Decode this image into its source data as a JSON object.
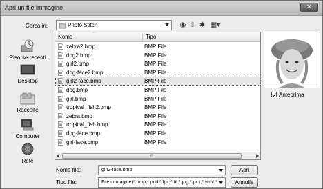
{
  "window": {
    "title": "Apri un file immagine",
    "close_glyph": "✕"
  },
  "lookin": {
    "label": "Cerca in:",
    "value": "Photo Stitch"
  },
  "toolbar": {
    "back": "◉",
    "up": "⇧",
    "new_folder": "✱",
    "views": "▦▾"
  },
  "places": [
    {
      "label": "Risorse recenti",
      "icon": "recent-places-icon"
    },
    {
      "label": "Desktop",
      "icon": "desktop-icon"
    },
    {
      "label": "Raccolte",
      "icon": "libraries-icon"
    },
    {
      "label": "Computer",
      "icon": "computer-icon"
    },
    {
      "label": "Rete",
      "icon": "network-icon"
    }
  ],
  "columns": {
    "name": "Nome",
    "type": "Tipo"
  },
  "files": [
    {
      "name": "zebra2.bmp",
      "type": "BMP File"
    },
    {
      "name": "dog2.bmp",
      "type": "BMP File"
    },
    {
      "name": "girl2.bmp",
      "type": "BMP File"
    },
    {
      "name": "dog-face2.bmp",
      "type": "BMP File"
    },
    {
      "name": "girl2-face.bmp",
      "type": "BMP File",
      "selected": true
    },
    {
      "name": "dog.bmp",
      "type": "BMP File"
    },
    {
      "name": "girl.bmp",
      "type": "BMP File"
    },
    {
      "name": "tropical_fish2.bmp",
      "type": "BMP File"
    },
    {
      "name": "zebra.bmp",
      "type": "BMP File"
    },
    {
      "name": "tropical_fish.bmp",
      "type": "BMP File"
    },
    {
      "name": "dog-face.bmp",
      "type": "BMP File"
    },
    {
      "name": "girl-face.bmp",
      "type": "BMP File"
    }
  ],
  "preview": {
    "checkbox_label": "Anteprima",
    "checked": true
  },
  "filename": {
    "label": "Nome file:",
    "value": "girl2-face.bmp"
  },
  "filetype": {
    "label": "Tipo file:",
    "value": "File immagine(*.bmp;*.pcd;*.fpx;*.tif;*.jpg;*.pcx;*.wmf;*."
  },
  "buttons": {
    "open": "Apri",
    "cancel": "Annulla"
  },
  "colors": {
    "selection": "#e5e5e5",
    "titlebar": "#c4c4c4"
  }
}
